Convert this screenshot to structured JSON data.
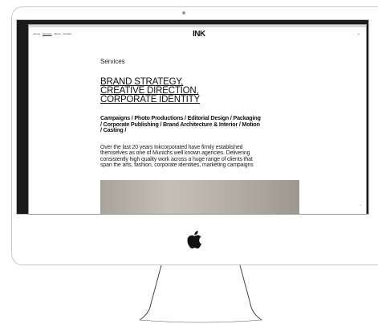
{
  "browser": {
    "nav_links": [
      "Home",
      "Services",
      "About",
      "Contact"
    ],
    "active_link": "Services",
    "logo_text": "INK"
  },
  "page": {
    "section_label": "Services",
    "headline_lines": [
      "BRAND STRATEGY,",
      "CREATIVE DIRECTION,",
      "CORPORATE IDENTITY"
    ],
    "services_lines": [
      "Campaigns / Photo Productions / Editorial Design / Packaging",
      "/ Corporate Publishing / Brand Architecture & Interior / Motion",
      "/ Casting /"
    ],
    "body_lines": [
      "Over the last 20 years Inkcorporated have firmly established",
      "themselves as one of Munichs well known agencies. Delivering",
      "consistently high quality work across a huge range of clients that",
      "span the arts, fashion, corporate identities, marketing campaigns"
    ]
  },
  "colors": {
    "bezel": "#1b1b1b",
    "frame_border": "#c9c9c9",
    "photo": "#b7b2a8"
  },
  "icons": [
    "apple-logo-icon",
    "camera-icon"
  ]
}
